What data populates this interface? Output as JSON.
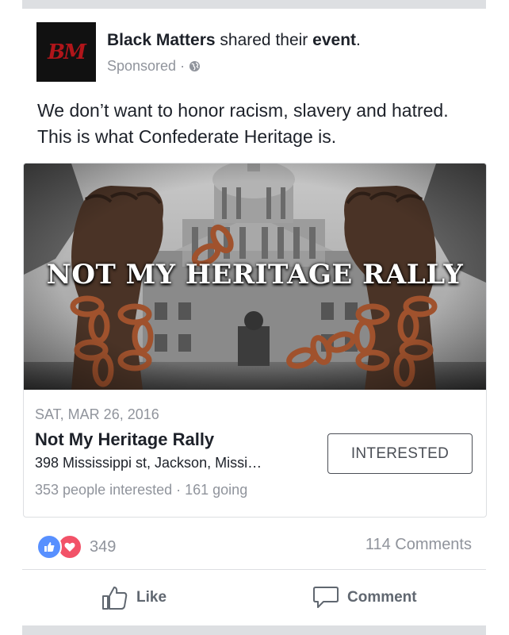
{
  "post": {
    "author": "Black Matters",
    "action_text": "shared their",
    "object": "event",
    "period": ".",
    "sponsored": "Sponsored",
    "dot": "·",
    "avatar_text": "BM",
    "body": "We don’t want to honor racism, slavery and hatred. This is what Confederate Heritage is."
  },
  "event": {
    "image_title": "NOT MY HERITAGE RALLY",
    "date": "SAT, MAR 26, 2016",
    "title": "Not My Heritage Rally",
    "address": "398 Mississippi st, Jackson, Missi…",
    "stats": "353 people interested · 161 going",
    "button_label": "INTERESTED"
  },
  "engagement": {
    "reaction_count": "349",
    "comments": "114 Comments",
    "like_label": "Like",
    "comment_label": "Comment"
  },
  "colors": {
    "like_blue": "#5890ff",
    "love_red": "#f25268",
    "avatar_red": "#b0151a"
  },
  "icons": [
    "globe-icon",
    "like-reaction-icon",
    "love-reaction-icon",
    "thumbs-up-icon",
    "comment-bubble-icon"
  ]
}
